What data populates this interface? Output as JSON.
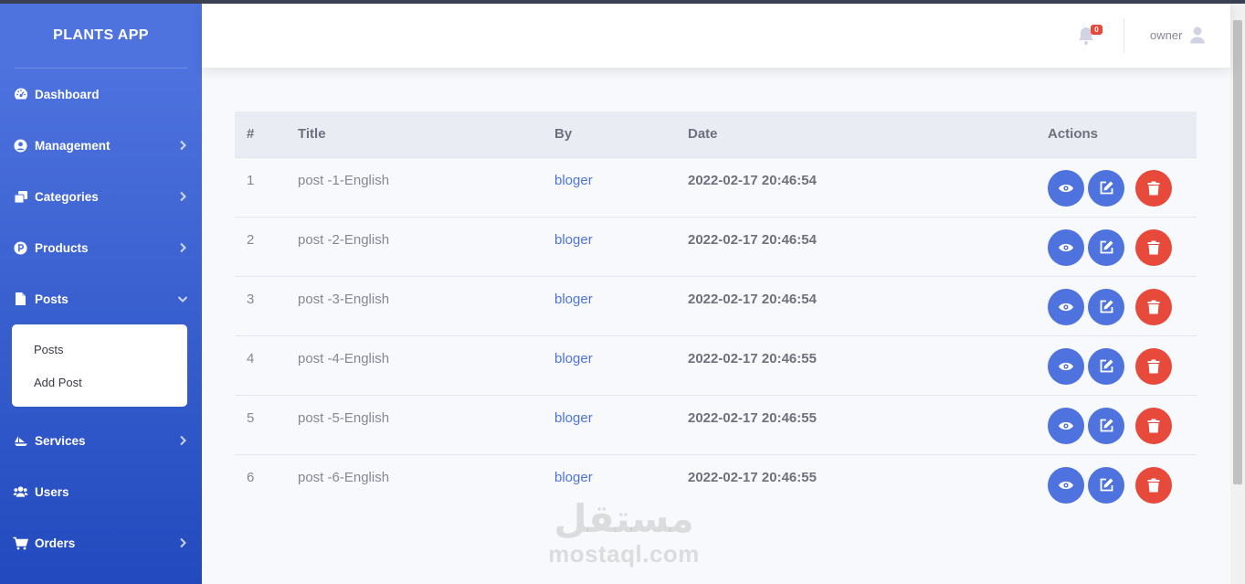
{
  "app": {
    "brand": "PLANTS APP"
  },
  "sidebar": {
    "items": [
      {
        "label": "Dashboard",
        "icon": "tachometer-icon",
        "chevron": null
      },
      {
        "label": "Management",
        "icon": "user-circle-icon",
        "chevron": "right"
      },
      {
        "label": "Categories",
        "icon": "copy-icon",
        "chevron": "right"
      },
      {
        "label": "Products",
        "icon": "product-circle-icon",
        "chevron": "right"
      },
      {
        "label": "Posts",
        "icon": "file-icon",
        "chevron": "down"
      },
      {
        "label": "Services",
        "icon": "ship-icon",
        "chevron": "right"
      },
      {
        "label": "Users",
        "icon": "users-icon",
        "chevron": null
      },
      {
        "label": "Orders",
        "icon": "cart-icon",
        "chevron": "right"
      }
    ],
    "posts_submenu": [
      "Posts",
      "Add Post"
    ]
  },
  "topbar": {
    "notification_count": "0",
    "username": "owner"
  },
  "table": {
    "headers": [
      "#",
      "Title",
      "By",
      "Date",
      "Actions"
    ],
    "rows": [
      {
        "num": "1",
        "title": "post -1-English",
        "by": "bloger",
        "date": "2022-02-17 20:46:54"
      },
      {
        "num": "2",
        "title": "post -2-English",
        "by": "bloger",
        "date": "2022-02-17 20:46:54"
      },
      {
        "num": "3",
        "title": "post -3-English",
        "by": "bloger",
        "date": "2022-02-17 20:46:54"
      },
      {
        "num": "4",
        "title": "post -4-English",
        "by": "bloger",
        "date": "2022-02-17 20:46:55"
      },
      {
        "num": "5",
        "title": "post -5-English",
        "by": "bloger",
        "date": "2022-02-17 20:46:55"
      },
      {
        "num": "6",
        "title": "post -6-English",
        "by": "bloger",
        "date": "2022-02-17 20:46:55"
      }
    ]
  },
  "watermark": {
    "arabic": "مستقل",
    "latin": "mostaql.com"
  },
  "colors": {
    "primary": "#4e73df",
    "danger": "#e74a3b",
    "sidebar_dark": "#224abe"
  }
}
